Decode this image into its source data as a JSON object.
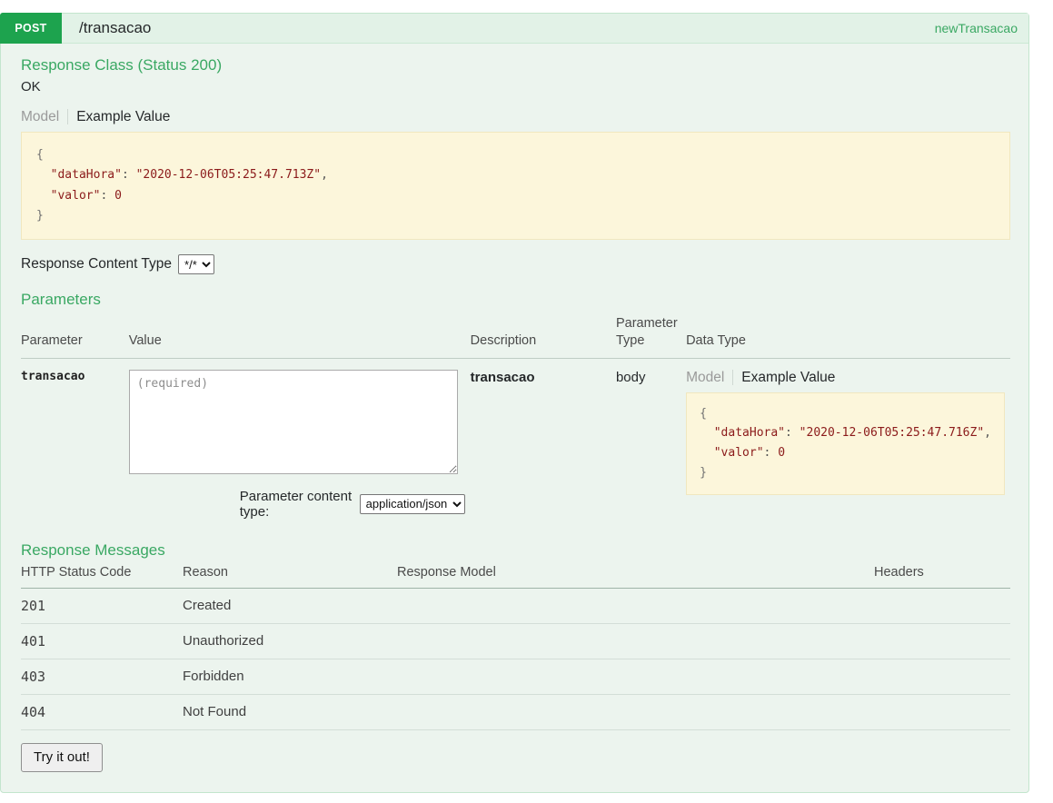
{
  "operation": {
    "method": "POST",
    "path": "/transacao",
    "nickname": "newTransacao",
    "accent_color": "#1da34e",
    "title_color": "#3aa863"
  },
  "response_class": {
    "heading": "Response Class (Status 200)",
    "status_text": "OK",
    "tabs": {
      "model": "Model",
      "example": "Example Value"
    },
    "example": {
      "line_open": "{",
      "field_1_key": "\"dataHora\"",
      "field_1_value": "\"2020-12-06T05:25:47.713Z\"",
      "field_2_key": "\"valor\"",
      "field_2_value": "0",
      "line_close": "}"
    }
  },
  "response_content_type": {
    "label": "Response Content Type",
    "selected": "*/*",
    "options": [
      "*/*"
    ]
  },
  "parameters_section": {
    "heading": "Parameters",
    "columns": {
      "parameter": "Parameter",
      "value": "Value",
      "description": "Description",
      "parameter_type": "Parameter Type",
      "data_type": "Data Type"
    },
    "rows": [
      {
        "name": "transacao",
        "value_placeholder": "(required)",
        "value": "",
        "description": "transacao",
        "parameter_type": "body",
        "data_type": {
          "tabs": {
            "model": "Model",
            "example": "Example Value"
          },
          "example": {
            "line_open": "{",
            "field_1_key": "\"dataHora\"",
            "field_1_value": "\"2020-12-06T05:25:47.716Z\"",
            "field_2_key": "\"valor\"",
            "field_2_value": "0",
            "line_close": "}"
          }
        }
      }
    ],
    "content_type": {
      "label": "Parameter content type:",
      "selected": "application/json",
      "options": [
        "application/json"
      ]
    }
  },
  "response_messages": {
    "heading": "Response Messages",
    "columns": {
      "status_code": "HTTP Status Code",
      "reason": "Reason",
      "response_model": "Response Model",
      "headers": "Headers"
    },
    "rows": [
      {
        "code": "201",
        "reason": "Created",
        "model": "",
        "headers": ""
      },
      {
        "code": "401",
        "reason": "Unauthorized",
        "model": "",
        "headers": ""
      },
      {
        "code": "403",
        "reason": "Forbidden",
        "model": "",
        "headers": ""
      },
      {
        "code": "404",
        "reason": "Not Found",
        "model": "",
        "headers": ""
      }
    ]
  },
  "actions": {
    "try_it_out": "Try it out!"
  },
  "punctuation": {
    "colon_space": ": ",
    "comma": ","
  }
}
